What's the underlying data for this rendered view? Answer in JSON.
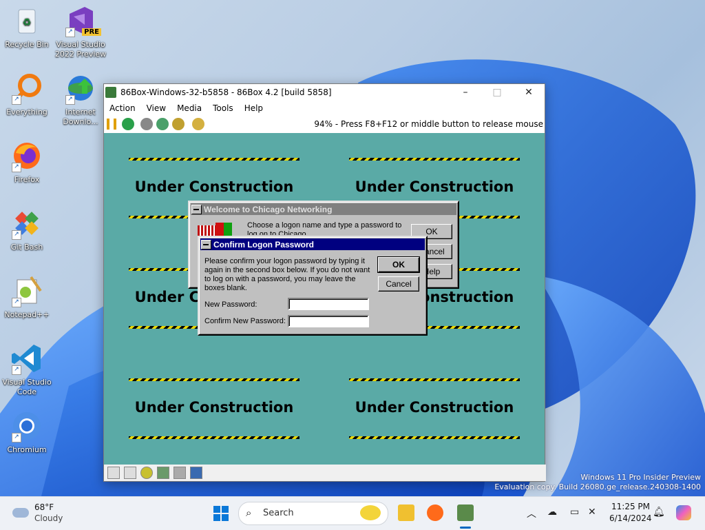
{
  "desktop": {
    "icons": [
      {
        "label": "Recycle Bin",
        "icon": "recycle-bin-icon"
      },
      {
        "label": "Visual Studio 2022 Preview",
        "icon": "visual-studio-icon",
        "badge": "PRE"
      },
      {
        "label": "Everything",
        "icon": "everything-search-icon"
      },
      {
        "label": "Internet Downlo...",
        "icon": "internet-download-manager-icon"
      },
      {
        "label": "Firefox",
        "icon": "firefox-icon"
      },
      {
        "label": "Git Bash",
        "icon": "git-bash-icon"
      },
      {
        "label": "Notepad++",
        "icon": "notepad-plus-plus-icon"
      },
      {
        "label": "Visual Studio Code",
        "icon": "vscode-icon"
      },
      {
        "label": "Chromium",
        "icon": "chromium-icon"
      }
    ],
    "watermark": {
      "line1": "Windows 11 Pro Insider Preview",
      "line2": "Evaluation copy. Build 26080.ge_release.240308-1400"
    }
  },
  "window": {
    "title": "86Box-Windows-32-b5858 - 86Box 4.2 [build 5858]",
    "menu": [
      "Action",
      "View",
      "Media",
      "Tools",
      "Help"
    ],
    "status_message": "94% - Press F8+F12 or middle button to release mouse",
    "controls": {
      "minimize": "–",
      "maximize": "□",
      "close": "✕"
    }
  },
  "guest": {
    "tile_text": "Under Construction",
    "welcome_dialog": {
      "title": "Welcome to Chicago Networking",
      "message": "Choose a logon name and type a password to log on to Chicago.",
      "buttons": [
        "OK",
        "Cancel",
        "Help"
      ]
    },
    "confirm_dialog": {
      "title": "Confirm Logon Password",
      "message": "Please confirm your logon password by typing it again in the second box below.  If you do not want to log on with a password, you may leave the boxes blank.",
      "new_password_label": "New Password:",
      "confirm_password_label": "Confirm New Password:",
      "ok": "OK",
      "cancel": "Cancel"
    }
  },
  "taskbar": {
    "weather": {
      "temp": "68°F",
      "condition": "Cloudy"
    },
    "search_placeholder": "Search",
    "time": "11:25 PM",
    "date": "6/14/2024",
    "colors": {
      "accent": "#0067c0",
      "win95_caption": "#000080",
      "teal": "#5aaaa6"
    }
  }
}
